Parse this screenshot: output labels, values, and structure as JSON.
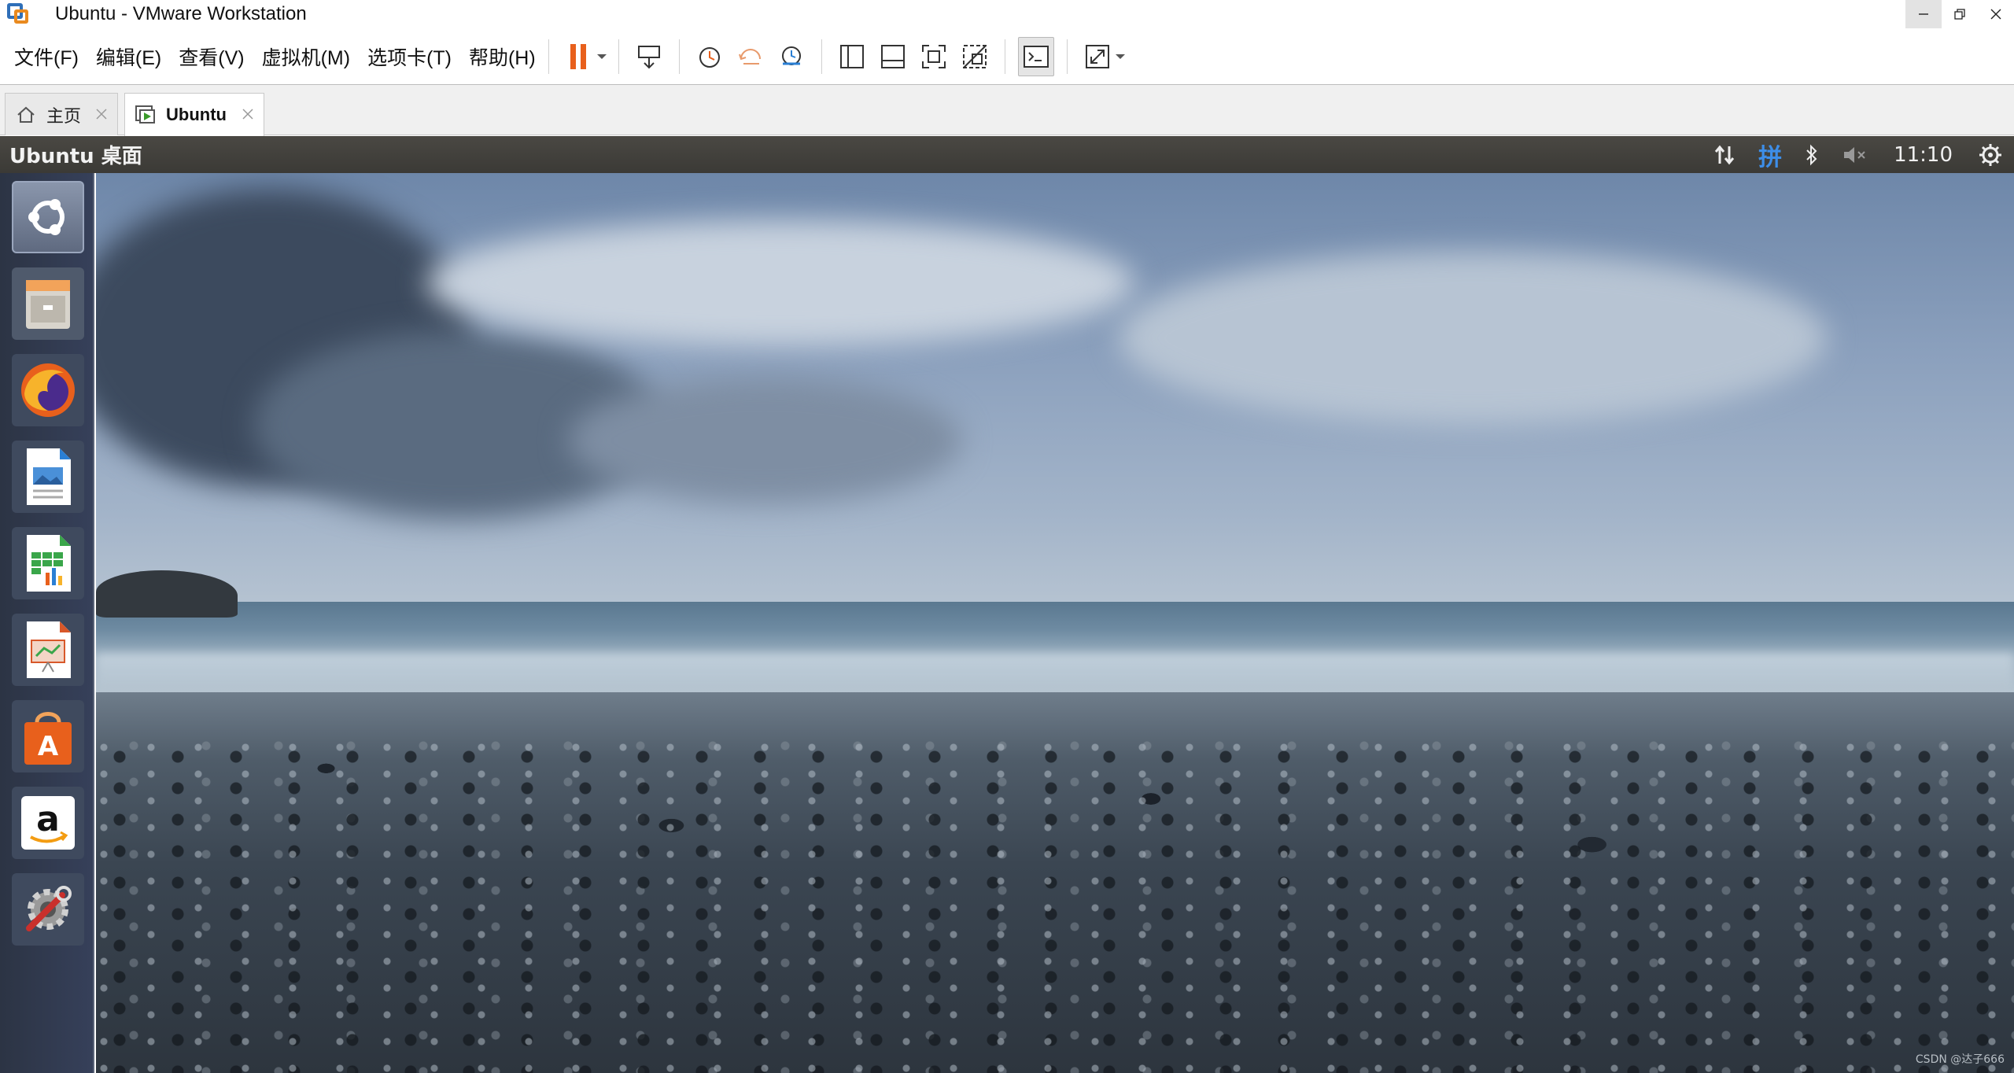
{
  "window": {
    "title": "Ubuntu - VMware Workstation"
  },
  "menu": {
    "items": [
      "文件(F)",
      "编辑(E)",
      "查看(V)",
      "虚拟机(M)",
      "选项卡(T)",
      "帮助(H)"
    ]
  },
  "tabs": [
    {
      "label": "主页",
      "icon": "home-icon",
      "active": false
    },
    {
      "label": "Ubuntu",
      "icon": "vm-icon",
      "active": true
    }
  ],
  "guest": {
    "panel_title": "Ubuntu 桌面",
    "ime": "拼",
    "clock": "11:10"
  },
  "launcher": {
    "items": [
      "ubuntu-dash",
      "files",
      "firefox",
      "libreoffice-writer",
      "libreoffice-calc",
      "libreoffice-impress",
      "ubuntu-software",
      "amazon",
      "system-settings"
    ]
  },
  "watermark": "CSDN @达子666",
  "colors": {
    "accent_orange": "#e8601c",
    "panel_bg": "#3b3a36",
    "launcher_bg": "#2c3444",
    "ime_blue": "#3d8ee8"
  }
}
